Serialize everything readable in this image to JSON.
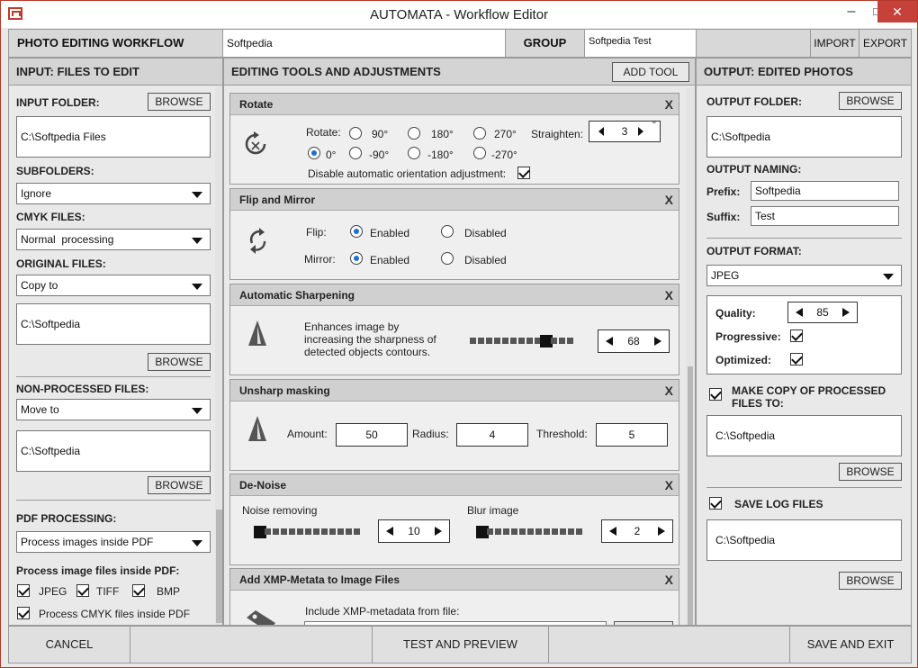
{
  "window": {
    "title": "AUTOMATA - Workflow Editor"
  },
  "topbar": {
    "workflow_label": "PHOTO EDITING WORKFLOW",
    "workflow_name": "Softpedia",
    "group_label": "GROUP",
    "group_value": "Softpedia Test",
    "import_label": "IMPORT",
    "export_label": "EXPORT"
  },
  "input": {
    "header": "INPUT: FILES TO EDIT",
    "folder_label": "INPUT FOLDER:",
    "browse": "BROWSE",
    "folder_value": "C:\\Softpedia Files",
    "subfolders_label": "SUBFOLDERS:",
    "subfolders_value": "Ignore",
    "cmyk_label": "CMYK FILES:",
    "cmyk_value": "Normal  processing",
    "original_label": "ORIGINAL FILES:",
    "original_value": "Copy to",
    "original_path": "C:\\Softpedia",
    "nonproc_label": "NON-PROCESSED FILES:",
    "nonproc_value": "Move to",
    "nonproc_path": "C:\\Softpedia",
    "pdf_label": "PDF PROCESSING:",
    "pdf_value": "Process images inside PDF",
    "pdf_types_label": "Process image files inside PDF:",
    "jpeg": "JPEG",
    "tiff": "TIFF",
    "bmp": "BMP",
    "cmyk_pdf": "Process CMYK files inside PDF"
  },
  "tools": {
    "header": "EDITING TOOLS AND ADJUSTMENTS",
    "add_tool": "ADD TOOL",
    "close": "X",
    "rotate": {
      "title": "Rotate",
      "rotate_label": "Rotate:",
      "opts_top": [
        "90°",
        "180°",
        "270°"
      ],
      "opts_bottom": [
        "0°",
        "-90°",
        "-180°",
        "-270°"
      ],
      "straighten_label": "Straighten:",
      "straighten_value": "3",
      "degree": "°",
      "disable_label": "Disable automatic orientation adjustment:"
    },
    "flip": {
      "title": "Flip and Mirror",
      "flip_label": "Flip:",
      "mirror_label": "Mirror:",
      "enabled": "Enabled",
      "disabled": "Disabled"
    },
    "sharpen": {
      "title": "Automatic Sharpening",
      "desc1": "Enhances image by",
      "desc2": "increasing the sharpness of",
      "desc3": "detected objects contours.",
      "value": "68"
    },
    "unsharp": {
      "title": "Unsharp masking",
      "amount_label": "Amount:",
      "amount": "50",
      "radius_label": "Radius:",
      "radius": "4",
      "threshold_label": "Threshold:",
      "threshold": "5"
    },
    "denoise": {
      "title": "De-Noise",
      "noise_label": "Noise removing",
      "noise_value": "10",
      "blur_label": "Blur image",
      "blur_value": "2"
    },
    "xmp": {
      "title": "Add XMP-Metata to Image Files",
      "include_label": "Include XMP-metadata from file:"
    }
  },
  "output": {
    "header": "OUTPUT: EDITED PHOTOS",
    "folder_label": "OUTPUT FOLDER:",
    "browse": "BROWSE",
    "folder_value": "C:\\Softpedia",
    "naming_label": "OUTPUT NAMING:",
    "prefix_label": "Prefix:",
    "prefix_value": "Softpedia",
    "suffix_label": "Suffix:",
    "suffix_value": "Test",
    "format_label": "OUTPUT FORMAT:",
    "format_value": "JPEG",
    "quality_label": "Quality:",
    "quality_value": "85",
    "progressive_label": "Progressive:",
    "optimized_label": "Optimized:",
    "copy_label_1": "MAKE COPY OF PROCESSED",
    "copy_label_2": "FILES TO:",
    "copy_path": "C:\\Softpedia",
    "log_label": "SAVE LOG FILES",
    "log_path": "C:\\Softpedia"
  },
  "bottom": {
    "cancel": "CANCEL",
    "test": "TEST AND PREVIEW",
    "save": "SAVE AND EXIT"
  },
  "colors": {
    "accent": "#1e6fd9",
    "close": "#c7413b"
  }
}
